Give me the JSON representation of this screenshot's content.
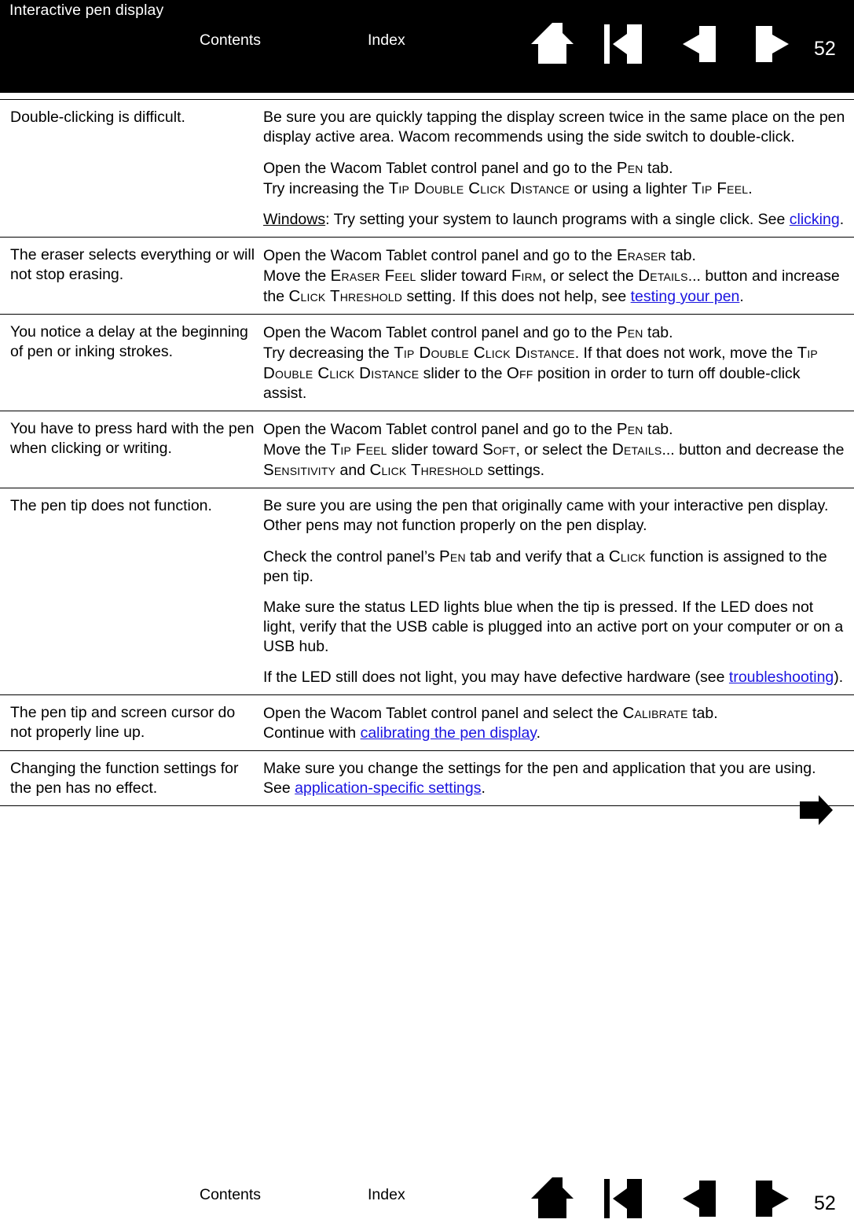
{
  "header": {
    "title": "Interactive pen display",
    "contents_label": "Contents",
    "index_label": "Index",
    "page_number": "52",
    "icons": [
      {
        "name": "home-icon",
        "label": "Home"
      },
      {
        "name": "go-to-first-icon",
        "label": "First page"
      },
      {
        "name": "previous-page-icon",
        "label": "Previous page"
      },
      {
        "name": "next-page-icon",
        "label": "Next page"
      }
    ],
    "background_color": "#000000",
    "text_color": "#ffffff"
  },
  "footer": {
    "contents_label": "Contents",
    "index_label": "Index",
    "page_number": "52",
    "text_color": "#000000"
  },
  "bottom_arrow": {
    "name": "continue-arrow",
    "label": "Continue"
  },
  "link_color": "#1a14e0",
  "table": {
    "rows": [
      {
        "symptom": "Double-clicking is difficult.",
        "paragraphs": [
          {
            "runs": [
              {
                "t": "Be sure you are quickly tapping the display screen twice in the same place on the pen display active area.  Wacom recommends using the side switch to double-click.",
                "s": "plain"
              }
            ]
          },
          {
            "runs": [
              {
                "t": "Open the Wacom Tablet control panel and go to the ",
                "s": "plain"
              },
              {
                "t": "Pen",
                "s": "smallcaps"
              },
              {
                "t": " tab.",
                "s": "plain"
              },
              {
                "t": "\n",
                "s": "break"
              },
              {
                "t": "Try increasing the ",
                "s": "plain"
              },
              {
                "t": "Tip Double Click Distance",
                "s": "smallcaps"
              },
              {
                "t": " or using a lighter ",
                "s": "plain"
              },
              {
                "t": "Tip Feel",
                "s": "smallcaps"
              },
              {
                "t": ".",
                "s": "plain"
              }
            ]
          },
          {
            "runs": [
              {
                "t": "Windows",
                "s": "emph"
              },
              {
                "t": ": Try setting your system to launch programs with a single click.  See ",
                "s": "plain"
              },
              {
                "t": "clicking",
                "s": "link"
              },
              {
                "t": ".",
                "s": "plain"
              }
            ]
          }
        ]
      },
      {
        "symptom": "The eraser selects everything or will not stop erasing.",
        "paragraphs": [
          {
            "runs": [
              {
                "t": "Open the Wacom Tablet control panel and go to the ",
                "s": "plain"
              },
              {
                "t": "Eraser",
                "s": "smallcaps"
              },
              {
                "t": " tab.",
                "s": "plain"
              },
              {
                "t": "\n",
                "s": "break"
              },
              {
                "t": "Move the ",
                "s": "plain"
              },
              {
                "t": "Eraser Feel",
                "s": "smallcaps"
              },
              {
                "t": " slider toward ",
                "s": "plain"
              },
              {
                "t": "Firm",
                "s": "smallcaps"
              },
              {
                "t": ", or select the ",
                "s": "plain"
              },
              {
                "t": "Details",
                "s": "smallcaps"
              },
              {
                "t": "... button and increase the ",
                "s": "plain"
              },
              {
                "t": "Click Threshold",
                "s": "smallcaps"
              },
              {
                "t": " setting.  If this does not help, see ",
                "s": "plain"
              },
              {
                "t": "testing your pen",
                "s": "link"
              },
              {
                "t": ".",
                "s": "plain"
              }
            ]
          }
        ]
      },
      {
        "symptom": "You notice a delay at the beginning of pen or inking strokes.",
        "paragraphs": [
          {
            "runs": [
              {
                "t": "Open the Wacom Tablet control panel and go to the ",
                "s": "plain"
              },
              {
                "t": "Pen",
                "s": "smallcaps"
              },
              {
                "t": " tab.",
                "s": "plain"
              },
              {
                "t": "\n",
                "s": "break"
              },
              {
                "t": "Try decreasing the ",
                "s": "plain"
              },
              {
                "t": "Tip Double Click Distance",
                "s": "smallcaps"
              },
              {
                "t": ".  If that does not work, move the ",
                "s": "plain"
              },
              {
                "t": "Tip Double Click Distance",
                "s": "smallcaps"
              },
              {
                "t": " slider to the ",
                "s": "plain"
              },
              {
                "t": "Off",
                "s": "smallcaps"
              },
              {
                "t": " position in order to turn off double-click assist.",
                "s": "plain"
              }
            ]
          }
        ]
      },
      {
        "symptom": "You have to press hard with the pen when clicking or writing.",
        "paragraphs": [
          {
            "runs": [
              {
                "t": "Open the Wacom Tablet control panel and go to the ",
                "s": "plain"
              },
              {
                "t": "Pen",
                "s": "smallcaps"
              },
              {
                "t": " tab.",
                "s": "plain"
              },
              {
                "t": "\n",
                "s": "break"
              },
              {
                "t": "Move the ",
                "s": "plain"
              },
              {
                "t": "Tip Feel",
                "s": "smallcaps"
              },
              {
                "t": " slider toward ",
                "s": "plain"
              },
              {
                "t": "Soft",
                "s": "smallcaps"
              },
              {
                "t": ", or select the ",
                "s": "plain"
              },
              {
                "t": "Details",
                "s": "smallcaps"
              },
              {
                "t": "... button and decrease the ",
                "s": "plain"
              },
              {
                "t": "Sensitivity",
                "s": "smallcaps"
              },
              {
                "t": " and ",
                "s": "plain"
              },
              {
                "t": "Click Threshold",
                "s": "smallcaps"
              },
              {
                "t": " settings.",
                "s": "plain"
              }
            ]
          }
        ]
      },
      {
        "symptom": "The pen tip does not function.",
        "paragraphs": [
          {
            "runs": [
              {
                "t": "Be sure you are using the pen that originally came with your interactive pen display.  Other pens may not function properly on the pen display.",
                "s": "plain"
              }
            ]
          },
          {
            "runs": [
              {
                "t": "Check the control panel’s ",
                "s": "plain"
              },
              {
                "t": "Pen",
                "s": "smallcaps"
              },
              {
                "t": " tab and verify that a ",
                "s": "plain"
              },
              {
                "t": "Click",
                "s": "smallcaps"
              },
              {
                "t": " function is assigned to the pen tip.",
                "s": "plain"
              }
            ]
          },
          {
            "runs": [
              {
                "t": "Make sure the status LED lights blue when the tip is pressed.  If the LED does not light, verify that the USB cable is plugged into an active port on your computer or on a USB hub.",
                "s": "plain"
              }
            ]
          },
          {
            "runs": [
              {
                "t": "If the LED still does not light, you may have defective hardware (see ",
                "s": "plain"
              },
              {
                "t": "troubleshooting",
                "s": "link"
              },
              {
                "t": ").",
                "s": "plain"
              }
            ]
          }
        ]
      },
      {
        "symptom": "The pen tip and screen cursor do not properly line up.",
        "paragraphs": [
          {
            "runs": [
              {
                "t": "Open the Wacom Tablet control panel and select the ",
                "s": "plain"
              },
              {
                "t": "Calibrate",
                "s": "smallcaps"
              },
              {
                "t": " tab.",
                "s": "plain"
              },
              {
                "t": "\n",
                "s": "break"
              },
              {
                "t": "Continue with ",
                "s": "plain"
              },
              {
                "t": "calibrating the pen display",
                "s": "link"
              },
              {
                "t": ".",
                "s": "plain"
              }
            ]
          }
        ]
      },
      {
        "symptom": "Changing the function settings for the pen has no effect.",
        "paragraphs": [
          {
            "runs": [
              {
                "t": "Make sure you change the settings for the pen and application that you are using.  See ",
                "s": "plain"
              },
              {
                "t": "application-specific settings",
                "s": "link"
              },
              {
                "t": ".",
                "s": "plain"
              }
            ]
          }
        ]
      }
    ]
  }
}
